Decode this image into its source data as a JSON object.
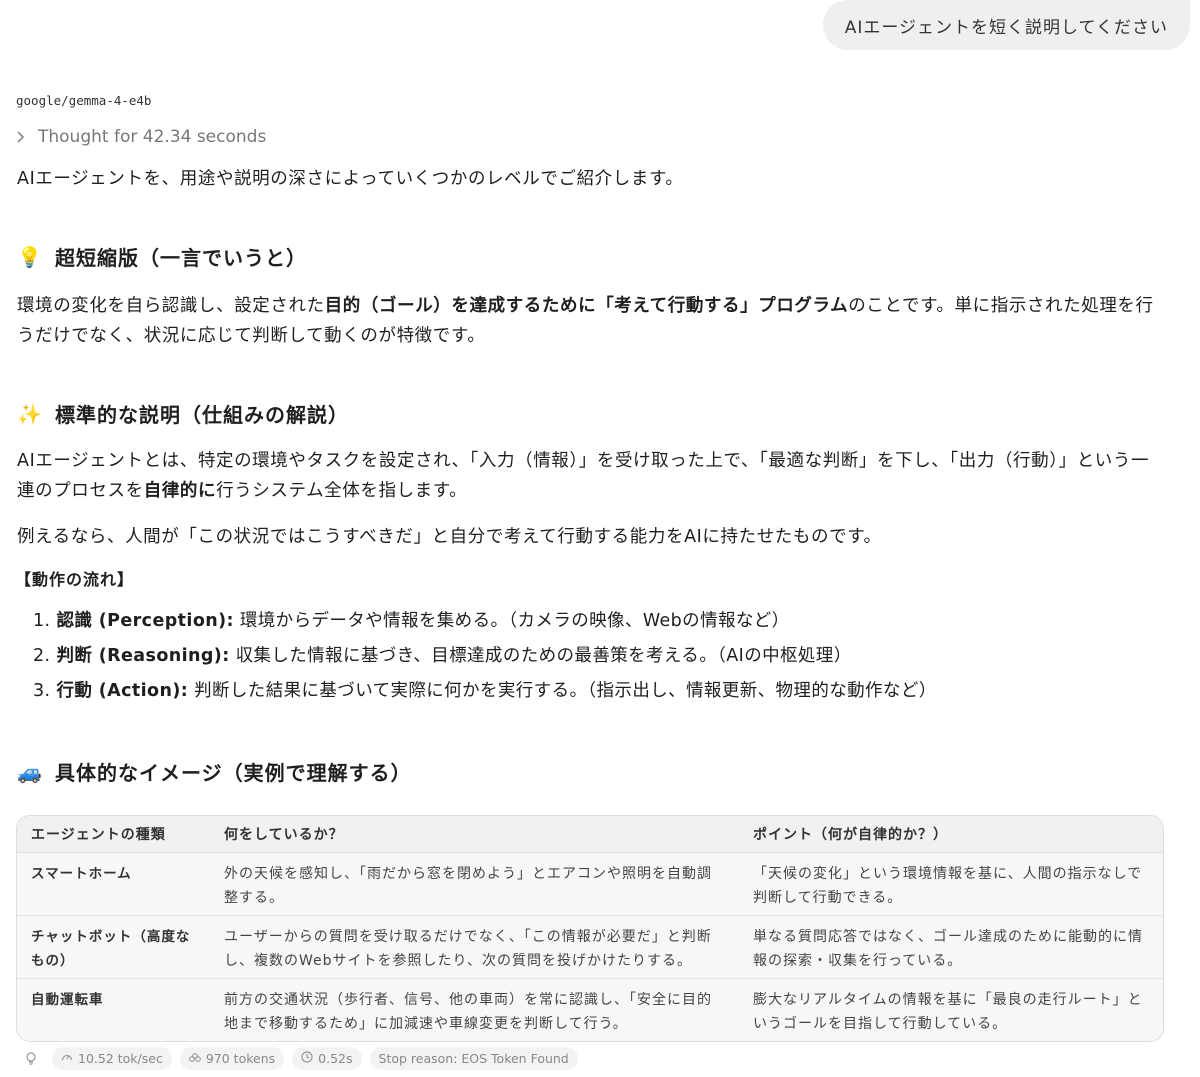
{
  "user_message": "AIエージェントを短く説明してください",
  "model_name": "google/gemma-4-e4b",
  "thought_label": "Thought for 42.34 seconds",
  "intro": "AIエージェントを、用途や説明の深さによっていくつかのレベルでご紹介します。",
  "section1": {
    "emoji": "💡",
    "title": "超短縮版（一言でいうと）",
    "p_a": "環境の変化を自ら認識し、設定された",
    "p_b": "目的（ゴール）を達成するために「考えて行動する」プログラム",
    "p_c": "のことです。単に指示された処理を行うだけでなく、状況に応じて判断して動くのが特徴です。"
  },
  "section2": {
    "emoji": "✨",
    "title": "標準的な説明（仕組みの解説）",
    "p1_a": "AIエージェントとは、特定の環境やタスクを設定され、「入力（情報）」を受け取った上で、「最適な判断」を下し、「出力（行動）」という一連のプロセスを",
    "p1_b": "自律的に",
    "p1_c": "行うシステム全体を指します。",
    "p2": "例えるなら、人間が「この状況ではこうすべきだ」と自分で考えて行動する能力をAIに持たせたものです。",
    "flow_title": "【動作の流れ】",
    "steps": [
      {
        "num": "1.",
        "label": "認識 (Perception):",
        "text": "環境からデータや情報を集める。（カメラの映像、Webの情報など）"
      },
      {
        "num": "2.",
        "label": "判断 (Reasoning):",
        "text": "収集した情報に基づき、目標達成のための最善策を考える。（AIの中枢処理）"
      },
      {
        "num": "3.",
        "label": "行動 (Action):",
        "text": "判断した結果に基づいて実際に何かを実行する。（指示出し、情報更新、物理的な動作など）"
      }
    ]
  },
  "section3": {
    "emoji": "🚙",
    "title": "具体的なイメージ（実例で理解する）"
  },
  "table": {
    "headers": [
      "エージェントの種類",
      "何をしているか？",
      "ポイント（何が自律的か？）"
    ],
    "rows": [
      [
        "スマートホーム",
        "外の天候を感知し、「雨だから窓を閉めよう」とエアコンや照明を自動調整する。",
        "「天候の変化」という環境情報を基に、人間の指示なしで判断して行動できる。"
      ],
      [
        "チャットボット（高度なもの）",
        "ユーザーからの質問を受け取るだけでなく、「この情報が必要だ」と判断し、複数のWebサイトを参照したり、次の質問を投げかけたりする。",
        "単なる質問応答ではなく、ゴール達成のために能動的に情報の探索・収集を行っている。"
      ],
      [
        "自動運転車",
        "前方の交通状況（歩行者、信号、他の車両）を常に認識し、「安全に目的地まで移動するため」に加減速や車線変更を判断して行う。",
        "膨大なリアルタイムの情報を基に「最良の走行ルート」というゴールを目指して行動している。"
      ]
    ]
  },
  "stats": {
    "speed": "10.52 tok/sec",
    "tokens": "970 tokens",
    "time": "0.52s",
    "stop_reason": "Stop reason: EOS Token Found"
  }
}
